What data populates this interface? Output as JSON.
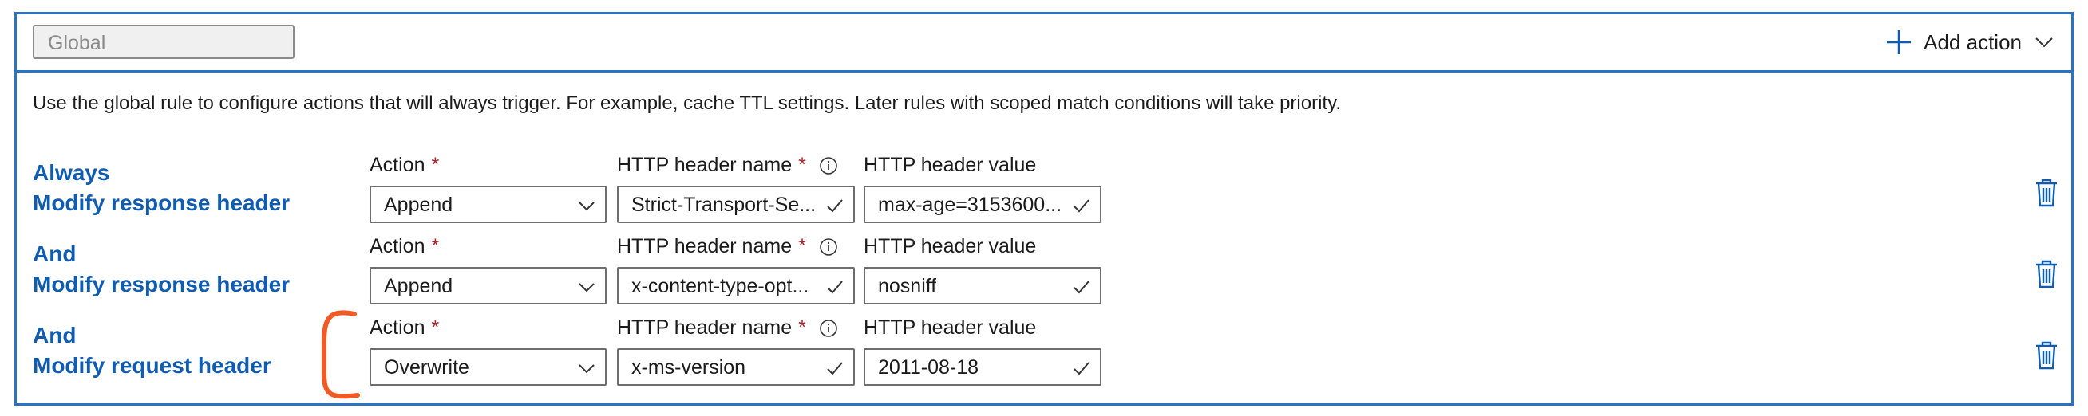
{
  "header": {
    "rule_name": "Global",
    "add_action_label": "Add action"
  },
  "description": "Use the global rule to configure actions that will always trigger. For example, cache TTL settings. Later rules with scoped match conditions will take priority.",
  "labels": {
    "action": "Action",
    "header_name": "HTTP header name",
    "header_value": "HTTP header value",
    "required_marker": "*"
  },
  "rows": [
    {
      "keyword": "Always",
      "action_title": "Modify response header",
      "action": "Append",
      "header_name": "Strict-Transport-Se...",
      "header_value": "max-age=3153600..."
    },
    {
      "keyword": "And",
      "action_title": "Modify response header",
      "action": "Append",
      "header_name": "x-content-type-opt...",
      "header_value": "nosniff"
    },
    {
      "keyword": "And",
      "action_title": "Modify request header",
      "action": "Overwrite",
      "header_name": "x-ms-version",
      "header_value": "2011-08-18"
    }
  ],
  "colors": {
    "accent_blue": "#2b73c7",
    "link_blue": "#0f5cb0",
    "required_red": "#a4262c",
    "annotation_orange": "#f15a24"
  },
  "icons": [
    "plus-icon",
    "chevron-down-icon",
    "info-icon",
    "check-icon",
    "trash-icon"
  ]
}
